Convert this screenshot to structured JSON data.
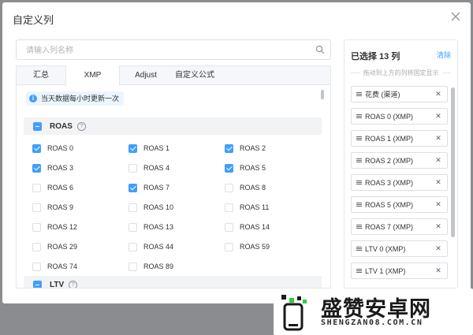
{
  "dialog": {
    "title": "自定义列",
    "search_placeholder": "请输入列名称"
  },
  "tabs": [
    {
      "label": "汇总",
      "active": false
    },
    {
      "label": "XMP",
      "active": true
    },
    {
      "label": "Adjust",
      "active": false
    },
    {
      "label": "自定义公式",
      "active": false
    }
  ],
  "notice": "当天数据每小时更新一次",
  "groups": {
    "roas": {
      "name": "ROAS",
      "state": "indeterminate",
      "options": [
        {
          "label": "ROAS 0",
          "checked": true
        },
        {
          "label": "ROAS 1",
          "checked": true
        },
        {
          "label": "ROAS 2",
          "checked": true
        },
        {
          "label": "ROAS 3",
          "checked": true
        },
        {
          "label": "ROAS 4",
          "checked": false
        },
        {
          "label": "ROAS 5",
          "checked": true
        },
        {
          "label": "ROAS 6",
          "checked": false
        },
        {
          "label": "ROAS 7",
          "checked": true
        },
        {
          "label": "ROAS 8",
          "checked": false
        },
        {
          "label": "ROAS 9",
          "checked": false
        },
        {
          "label": "ROAS 10",
          "checked": false
        },
        {
          "label": "ROAS 11",
          "checked": false
        },
        {
          "label": "ROAS 12",
          "checked": false
        },
        {
          "label": "ROAS 13",
          "checked": false
        },
        {
          "label": "ROAS 14",
          "checked": false
        },
        {
          "label": "ROAS 29",
          "checked": false
        },
        {
          "label": "ROAS 44",
          "checked": false
        },
        {
          "label": "ROAS 59",
          "checked": false
        },
        {
          "label": "ROAS 74",
          "checked": false
        },
        {
          "label": "ROAS 89",
          "checked": false
        }
      ]
    },
    "ltv": {
      "name": "LTV",
      "state": "indeterminate"
    }
  },
  "selected": {
    "title": "已选择 13 列",
    "clear_label": "清除",
    "hint": "拖动到上方的列将固定显示",
    "items": [
      "花费 (渠道)",
      "ROAS 0 (XMP)",
      "ROAS 1 (XMP)",
      "ROAS 2 (XMP)",
      "ROAS 3 (XMP)",
      "ROAS 5 (XMP)",
      "ROAS 7 (XMP)",
      "LTV 0 (XMP)",
      "LTV 1 (XMP)"
    ]
  },
  "watermark": {
    "title": "盛赞安卓网",
    "url": "SHENGZAN08.COM.CN"
  },
  "colors": {
    "primary": "#409eff",
    "border": "#dcdfe6",
    "overlay": "#6f7276"
  }
}
